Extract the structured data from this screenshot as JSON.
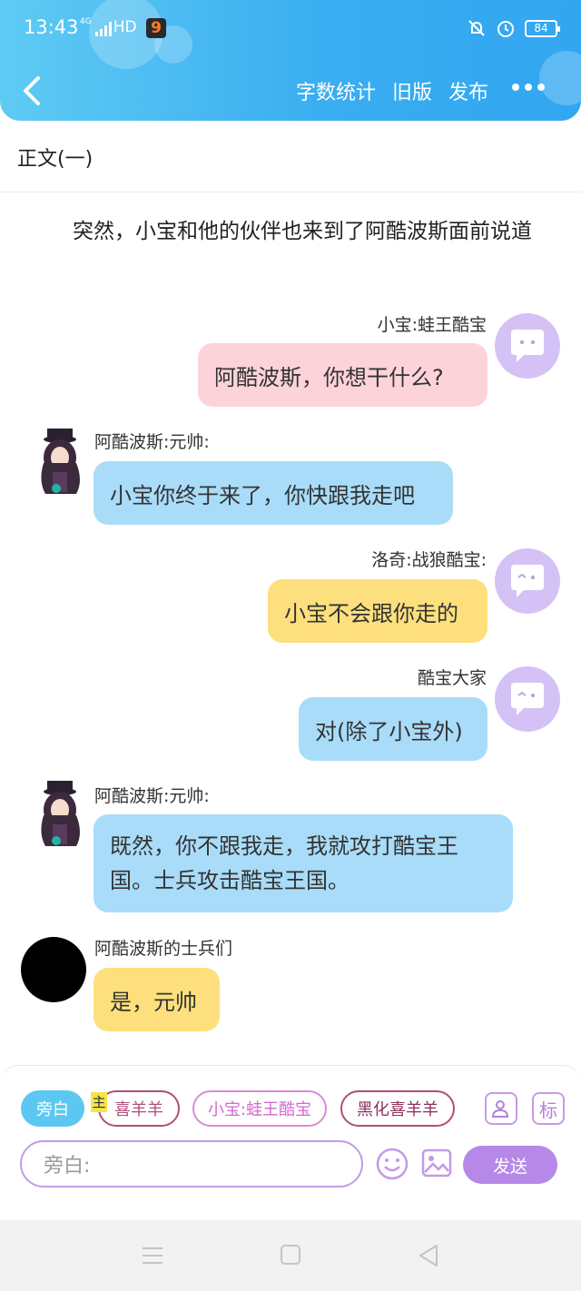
{
  "status_bar": {
    "time": "13:43",
    "network": "4G",
    "hd": "HD",
    "battery": "84"
  },
  "toolbar": {
    "word_count": "字数统计",
    "old_version": "旧版",
    "publish": "发布"
  },
  "chapter_title": "正文(一)",
  "narration": "突然，小宝和他的伙伴也来到了阿酷波斯面前说道",
  "messages": [
    {
      "name": "小宝:蛙王酷宝",
      "text": "阿酷波斯，你想干什么?"
    },
    {
      "name": "阿酷波斯:元帅:",
      "text": "小宝你终于来了，你快跟我走吧"
    },
    {
      "name": "洛奇:战狼酷宝:",
      "text": "小宝不会跟你走的"
    },
    {
      "name": "酷宝大家",
      "text": "对(除了小宝外)"
    },
    {
      "name": "阿酷波斯:元帅:",
      "text": "既然，你不跟我走，我就攻打酷宝王国。士兵攻击酷宝王国。"
    },
    {
      "name": "阿酷波斯的士兵们",
      "text": "是，元帅"
    }
  ],
  "compose": {
    "chips": {
      "narration": "旁白",
      "main_tag": "主",
      "xiyangyang": "喜羊羊",
      "xiaobao": "小宝:蛙王酷宝",
      "heihua": "黑化喜羊羊"
    },
    "mark_label": "标",
    "input_placeholder": "旁白:",
    "send_label": "发送"
  },
  "colors": {
    "header": "#3aaef0",
    "bubble_pink": "#fdd3da",
    "bubble_blue": "#a9dcf8",
    "bubble_yellow": "#fde07d",
    "accent_purple": "#b688e8"
  }
}
